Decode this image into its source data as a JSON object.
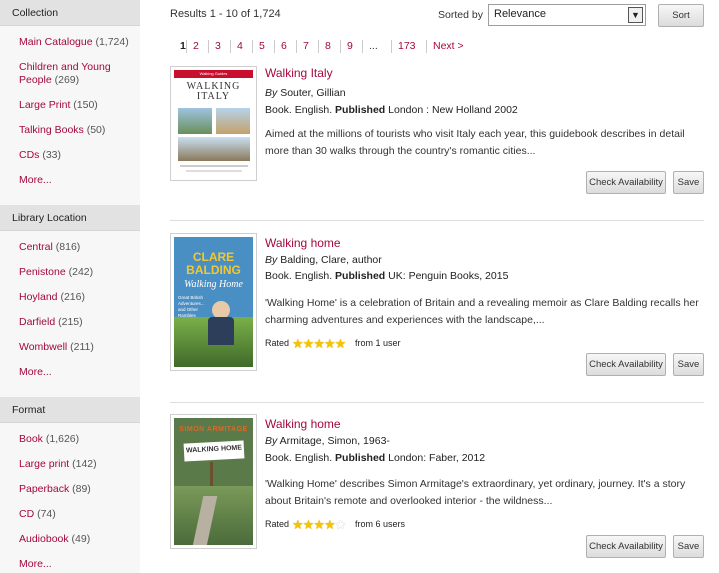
{
  "sidebar": {
    "facets": [
      {
        "heading": "Collection",
        "items": [
          {
            "label": "Main Catalogue",
            "count": "(1,724)"
          },
          {
            "label": "Children and Young People",
            "count": "(269)"
          },
          {
            "label": "Large Print",
            "count": "(150)"
          },
          {
            "label": "Talking Books",
            "count": "(50)"
          },
          {
            "label": "CDs",
            "count": "(33)"
          }
        ],
        "more": "More..."
      },
      {
        "heading": "Library Location",
        "items": [
          {
            "label": "Central",
            "count": "(816)"
          },
          {
            "label": "Penistone",
            "count": "(242)"
          },
          {
            "label": "Hoyland",
            "count": "(216)"
          },
          {
            "label": "Darfield",
            "count": "(215)"
          },
          {
            "label": "Wombwell",
            "count": "(211)"
          }
        ],
        "more": "More..."
      },
      {
        "heading": "Format",
        "items": [
          {
            "label": "Book",
            "count": "(1,626)"
          },
          {
            "label": "Large print",
            "count": "(142)"
          },
          {
            "label": "Paperback",
            "count": "(89)"
          },
          {
            "label": "CD",
            "count": "(74)"
          },
          {
            "label": "Audiobook",
            "count": "(49)"
          }
        ],
        "more": "More..."
      }
    ]
  },
  "toolbar": {
    "results_count": "Results 1 - 10 of 1,724",
    "sort_label": "Sorted by",
    "sort_value": "Relevance",
    "sort_button": "Sort"
  },
  "pagination": {
    "pages": [
      "1",
      "2",
      "3",
      "4",
      "5",
      "6",
      "7",
      "8",
      "9"
    ],
    "current": "1",
    "ellipsis": "...",
    "last": "173",
    "next": "Next >"
  },
  "results": [
    {
      "title": "Walking Italy",
      "by_label": "By",
      "author": "Souter, Gillian",
      "format": "Book. English.",
      "published_label": "Published",
      "published": "London : New Holland 2002",
      "description": "Aimed at the millions of tourists who visit Italy each year, this guidebook describes in detail more than 30 walks through the country's romantic cities...",
      "check_label": "Check Availability",
      "save_label": "Save",
      "cover": {
        "series": "Walking Guides",
        "title": "WALKING ITALY",
        "bg": "#ffffff",
        "accent": "#c8102e"
      }
    },
    {
      "title": "Walking home",
      "by_label": "By",
      "author": "Balding, Clare, author",
      "format": "Book. English.",
      "published_label": "Published",
      "published": "UK: Penguin Books, 2015",
      "description": "'Walking Home' is a celebration of Britain and a revealing memoir as Clare Balding recalls her charming adventures and experiences with the landscape,...",
      "rated_label": "Rated",
      "rating": 5,
      "rating_from": "from 1 user",
      "check_label": "Check Availability",
      "save_label": "Save",
      "cover": {
        "series": "",
        "title": "CLARE BALDING",
        "subtitle": "Walking Home",
        "tagline": "Great British Adventures... and Other Rambles",
        "bg": "#4a8fc4",
        "accent": "#f2c830"
      }
    },
    {
      "title": "Walking home",
      "by_label": "By",
      "author": "Armitage, Simon, 1963-",
      "format": "Book. English.",
      "published_label": "Published",
      "published": "London: Faber, 2012",
      "description": "'Walking Home' describes Simon Armitage's extraordinary, yet ordinary, journey. It's a story about Britain's remote and overlooked interior - the wildness...",
      "rated_label": "Rated",
      "rating": 4,
      "rating_from": "from 6 users",
      "check_label": "Check Availability",
      "save_label": "Save",
      "cover": {
        "series": "",
        "title": "SIMON ARMITAGE",
        "subtitle": "WALKING HOME",
        "bg": "#5a7a4a",
        "accent": "#d86a2a"
      }
    }
  ]
}
